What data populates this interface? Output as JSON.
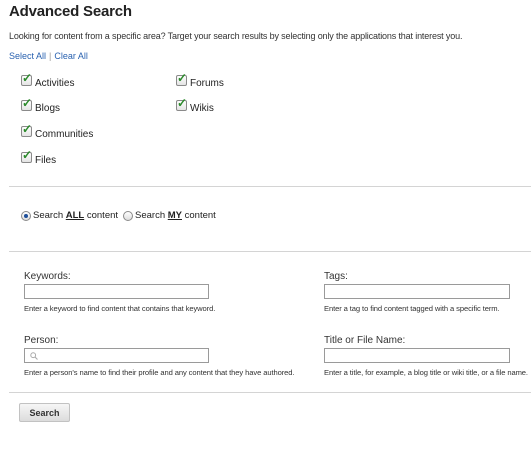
{
  "header": {
    "title": "Advanced Search",
    "intro": "Looking for content from a specific area? Target your search results by selecting only the applications that interest you."
  },
  "selection_links": {
    "select_all": "Select All",
    "separator": "|",
    "clear_all": "Clear All"
  },
  "applications": [
    {
      "label": "Activities",
      "checked": true
    },
    {
      "label": "Blogs",
      "checked": true
    },
    {
      "label": "Communities",
      "checked": true
    },
    {
      "label": "Files",
      "checked": true
    },
    {
      "label": "Forums",
      "checked": true
    },
    {
      "label": "Wikis",
      "checked": true
    }
  ],
  "scope": {
    "all": {
      "prefix": "Search ",
      "emphasis": "ALL",
      "suffix": " content",
      "selected": true
    },
    "my": {
      "prefix": "Search ",
      "emphasis": "MY",
      "suffix": " content",
      "selected": false
    }
  },
  "fields": {
    "keywords": {
      "label": "Keywords:",
      "value": "",
      "help": "Enter a keyword to find content that contains that keyword."
    },
    "tags": {
      "label": "Tags:",
      "value": "",
      "help": "Enter a tag to find content tagged with a specific term."
    },
    "person": {
      "label": "Person:",
      "value": "",
      "icon": "search-icon",
      "help": "Enter a person's name to find their profile and any content that they have authored."
    },
    "title": {
      "label": "Title or File Name:",
      "value": "",
      "help": "Enter a title, for example, a blog title or wiki title, or a file name."
    }
  },
  "actions": {
    "search_label": "Search"
  },
  "colors": {
    "link": "#2a62b0",
    "check": "#2b8a2b",
    "divider": "#d4d4d4",
    "radio_dot": "#1e4f9a"
  }
}
